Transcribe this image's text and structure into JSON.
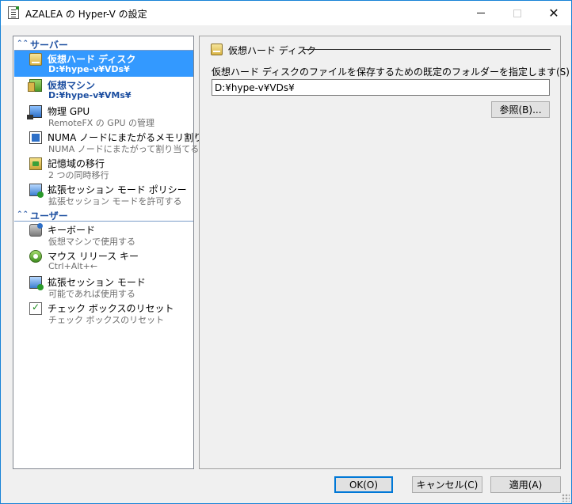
{
  "window": {
    "title": "AZALEA の Hyper-V の設定"
  },
  "sidebar": {
    "server_header": "サーバー",
    "user_header": "ユーザー",
    "server_items": [
      {
        "name": "仮想ハード ディスク",
        "sub": "D:¥hype-v¥VDs¥",
        "icon": "virtual-disk-icon"
      },
      {
        "name": "仮想マシン",
        "sub": "D:¥hype-v¥VMs¥",
        "icon": "virtual-machine-icon"
      },
      {
        "name": "物理 GPU",
        "sub": "RemoteFX の GPU の管理",
        "icon": "gpu-icon"
      },
      {
        "name": "NUMA ノードにまたがるメモリ割り当て",
        "sub": "NUMA ノードにまたがって割り当てる",
        "icon": "numa-icon"
      },
      {
        "name": "記憶域の移行",
        "sub": "2 つの同時移行",
        "icon": "storage-migration-icon"
      },
      {
        "name": "拡張セッション モード ポリシー",
        "sub": "拡張セッション モードを許可する",
        "icon": "session-policy-icon"
      }
    ],
    "user_items": [
      {
        "name": "キーボード",
        "sub": "仮想マシンで使用する",
        "icon": "keyboard-icon"
      },
      {
        "name": "マウス リリース キー",
        "sub": "Ctrl+Alt+←",
        "icon": "mouse-icon"
      },
      {
        "name": "拡張セッション モード",
        "sub": "可能であれば使用する",
        "icon": "session-icon"
      },
      {
        "name": "チェック ボックスのリセット",
        "sub": "チェック ボックスのリセット",
        "icon": "checkbox-reset-icon"
      }
    ]
  },
  "main": {
    "section_title": "仮想ハード ディスク",
    "description": "仮想ハード ディスクのファイルを保存するための既定のフォルダーを指定します(S)",
    "path_value": "D:¥hype-v¥VDs¥",
    "browse_label": "参照(B)..."
  },
  "footer": {
    "ok_label": "OK(O)",
    "cancel_label": "キャンセル(C)",
    "apply_label": "適用(A)"
  },
  "colors": {
    "selection": "#3399ff",
    "header_text": "#1c4ea0",
    "window_border": "#1883d7"
  }
}
